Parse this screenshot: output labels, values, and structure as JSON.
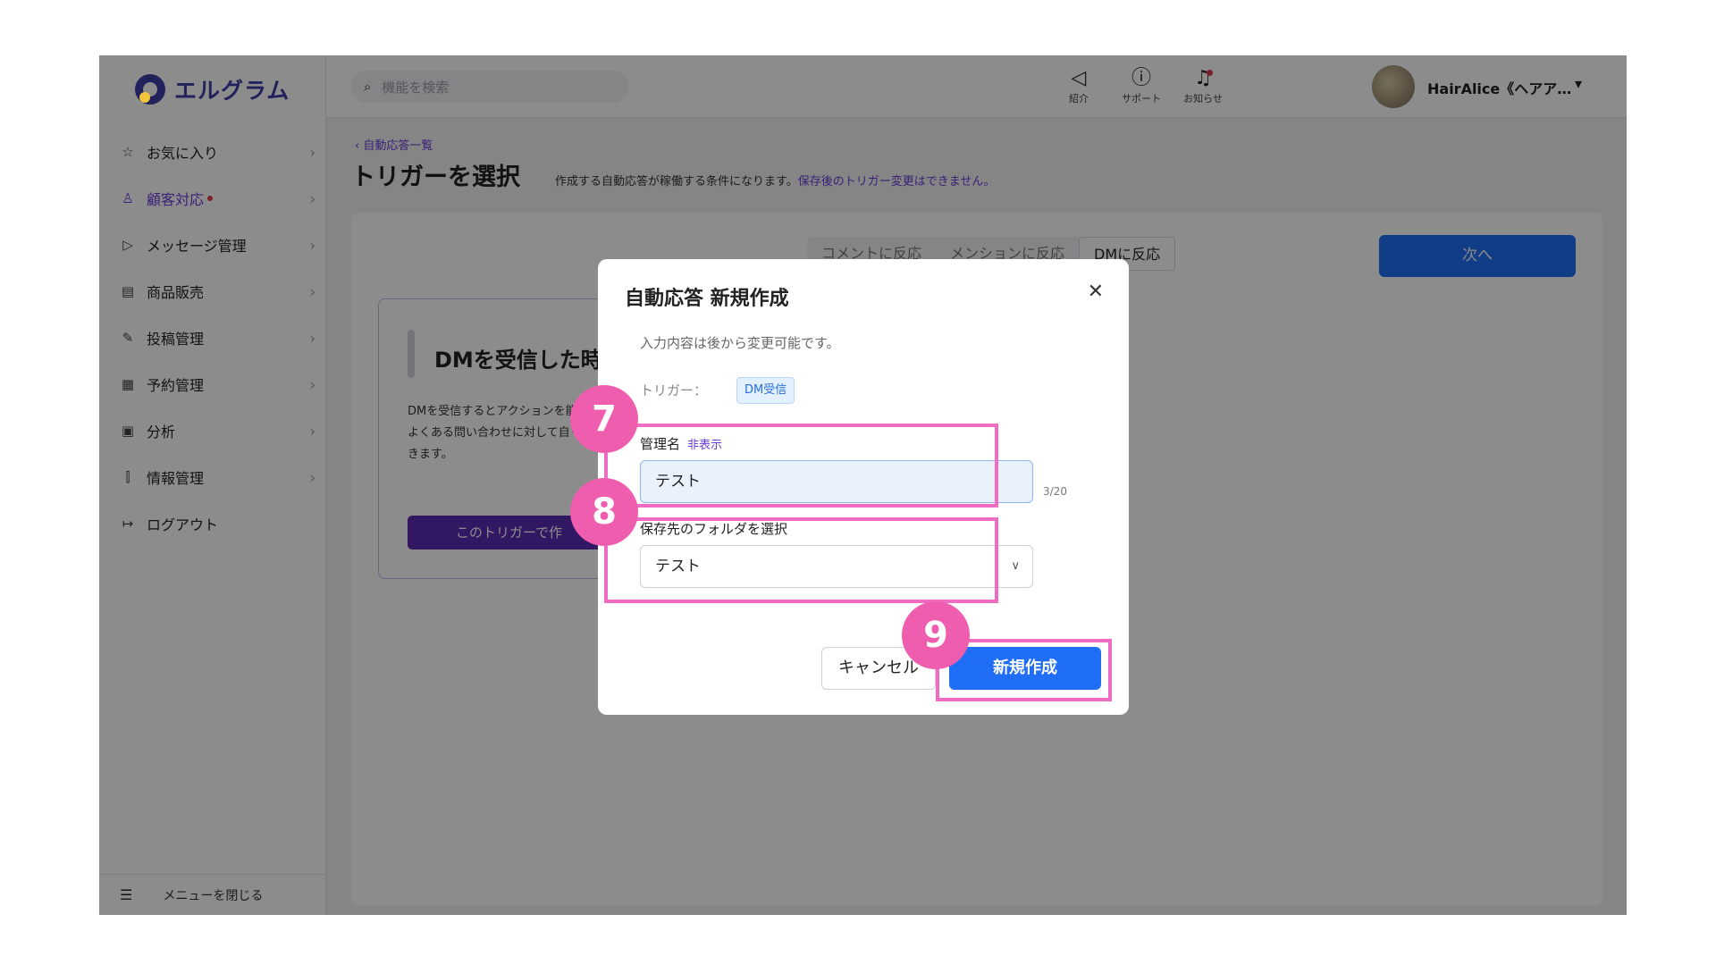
{
  "app": {
    "logo_text": "エルグラム"
  },
  "sidebar": {
    "items": [
      {
        "label": "お気に入り",
        "icon": "star-icon"
      },
      {
        "label": "顧客対応",
        "icon": "person-icon",
        "active": true,
        "badge": true
      },
      {
        "label": "メッセージ管理",
        "icon": "send-icon"
      },
      {
        "label": "商品販売",
        "icon": "shop-icon"
      },
      {
        "label": "投稿管理",
        "icon": "edit-icon"
      },
      {
        "label": "予約管理",
        "icon": "calendar-icon"
      },
      {
        "label": "分析",
        "icon": "report-icon"
      },
      {
        "label": "情報管理",
        "icon": "chart-icon"
      },
      {
        "label": "ログアウト",
        "icon": "logout-icon"
      }
    ],
    "collapse_label": "メニューを閉じる"
  },
  "topbar": {
    "search_placeholder": "機能を検索",
    "icons": [
      {
        "label": "紹介",
        "icon": "megaphone-icon"
      },
      {
        "label": "サポート",
        "icon": "help-icon"
      },
      {
        "label": "お知らせ",
        "icon": "bell-icon"
      }
    ],
    "username": "HairAlice《ヘアア…"
  },
  "page": {
    "breadcrumb": "自動応答一覧",
    "title": "トリガーを選択",
    "description": "作成する自動応答が稼働する条件になります。",
    "description_warning": "保存後のトリガー変更はできません。",
    "tabs": [
      "コメントに反応",
      "メンションに反応",
      "DMに反応"
    ],
    "active_tab": "DMに反応",
    "next_button": "次へ",
    "card": {
      "title": "DMを受信した時",
      "description": "DMを受信するとアクションを能です。よくある問い合わせに対して自く対応できます。",
      "button": "このトリガーで作"
    }
  },
  "modal": {
    "title": "自動応答 新規作成",
    "note": "入力内容は後から変更可能です。",
    "trigger_label": "トリガー：",
    "trigger_value": "DM受信",
    "name_label": "管理名",
    "name_hide": "非表示",
    "name_value": "テスト",
    "name_counter": "3/20",
    "folder_label": "保存先のフォルダを選択",
    "folder_value": "テスト",
    "cancel_button": "キャンセル",
    "create_button": "新規作成"
  },
  "steps": [
    "7",
    "8",
    "9"
  ],
  "colors": {
    "accent": "#6b3bd8",
    "primary_button": "#1f6ef5",
    "highlight": "#f06cc4",
    "step_badge": "#ef5eae"
  }
}
